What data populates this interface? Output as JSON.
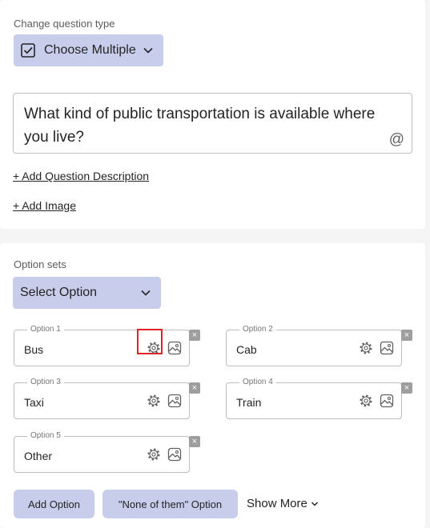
{
  "question_card": {
    "type_label": "Change question type",
    "type_button": {
      "icon": "checkbox-icon",
      "label": "Choose Multiple"
    },
    "question_text": "What kind of public transportation is available where you live?",
    "mention_symbol": "@",
    "add_description": "+ Add Question Description",
    "add_image": "+ Add Image"
  },
  "options_card": {
    "option_sets_label": "Option sets",
    "select_option": "Select Option",
    "options": [
      {
        "legend": "Option 1",
        "value": "Bus"
      },
      {
        "legend": "Option 2",
        "value": "Cab"
      },
      {
        "legend": "Option 3",
        "value": "Taxi"
      },
      {
        "legend": "Option 4",
        "value": "Train"
      },
      {
        "legend": "Option 5",
        "value": "Other"
      }
    ],
    "remove_symbol": "×",
    "add_option": "Add Option",
    "none_option": "\"None of them\" Option",
    "show_more": "Show More"
  },
  "colors": {
    "button_bg": "#c9cdec",
    "highlight": "#e02424"
  }
}
